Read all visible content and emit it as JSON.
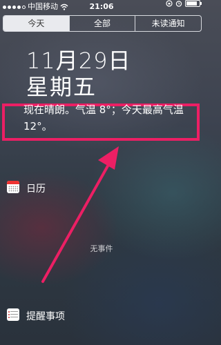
{
  "status_bar": {
    "carrier": "中国移动",
    "time": "21:06",
    "battery_level": 0.85
  },
  "tabs": [
    {
      "label": "今天",
      "active": true
    },
    {
      "label": "全部",
      "active": false
    },
    {
      "label": "未读通知",
      "active": false
    }
  ],
  "today": {
    "date": "11月29日",
    "weekday": "星期五",
    "weather": "现在晴朗。气温 8°；今天最高气温 12°。"
  },
  "calendar": {
    "title": "日历",
    "empty_text": "无事件"
  },
  "reminders": {
    "title": "提醒事项"
  },
  "colors": {
    "highlight": "#ec1f64",
    "active_tab_bg": "#e9eaee"
  },
  "icons": [
    "signal-dots-icon",
    "wifi-icon",
    "orientation-lock-icon",
    "alarm-icon",
    "battery-icon",
    "calendar-icon",
    "reminders-icon",
    "annotation-arrow"
  ]
}
